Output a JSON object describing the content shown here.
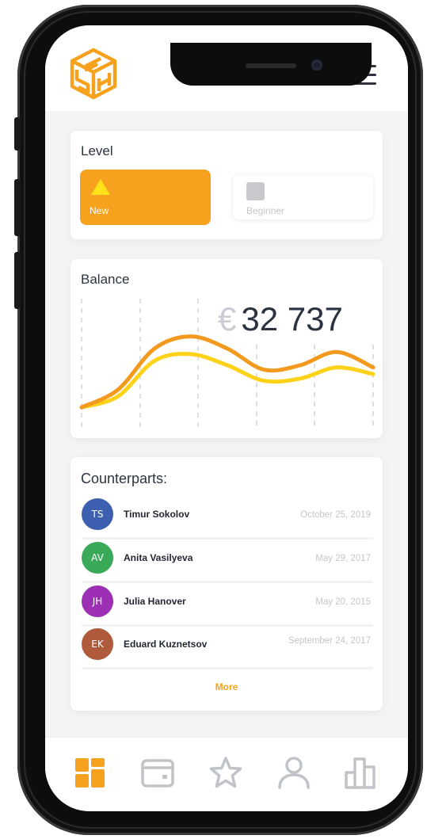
{
  "colors": {
    "accent": "#f6a21e",
    "yellow": "#ffe21a",
    "dark_text": "#2b3340",
    "muted": "#c3c6cc",
    "inactive_icon": "#c0c4c9"
  },
  "header": {
    "logo_icon": "cube-logo-icon",
    "menu_icon": "hamburger-menu-icon"
  },
  "level": {
    "title": "Level",
    "options": [
      {
        "label": "New",
        "icon": "triangle-icon",
        "selected": true
      },
      {
        "label": "Beginner",
        "icon": "square-icon",
        "selected": false
      }
    ]
  },
  "balance": {
    "title": "Balance",
    "currency": "€",
    "amount": "32 737"
  },
  "chart_data": {
    "type": "line",
    "title": "",
    "xlabel": "",
    "ylabel": "",
    "x": [
      0,
      1,
      2,
      3,
      4,
      5,
      6,
      7,
      8
    ],
    "series": [
      {
        "color": "#f39a1e",
        "values": [
          0.02,
          0.18,
          0.55,
          0.66,
          0.55,
          0.36,
          0.4,
          0.52,
          0.38
        ]
      },
      {
        "color": "#ffd21a",
        "values": [
          0.02,
          0.12,
          0.44,
          0.5,
          0.4,
          0.26,
          0.28,
          0.38,
          0.32
        ]
      }
    ],
    "grid": "vertical dashed",
    "ylim": [
      0,
      1
    ]
  },
  "counterparts": {
    "title": "Counterparts:",
    "items": [
      {
        "initials": "TS",
        "name": "Timur Sokolov",
        "date": "October 25, 2019",
        "avatar_color": "#3d5fb0"
      },
      {
        "initials": "AV",
        "name": "Anita Vasilyeva",
        "date": "May 29, 2017",
        "avatar_color": "#3aa958"
      },
      {
        "initials": "JH",
        "name": "Julia Hanover",
        "date": "May 20, 2015",
        "avatar_color": "#9d2fb5"
      },
      {
        "initials": "EK",
        "name": "Eduard Kuznetsov",
        "date": "September 24, 2017",
        "avatar_color": "#b05a3c"
      }
    ],
    "more_label": "More"
  },
  "tabbar": {
    "tabs": [
      {
        "icon": "dashboard-grid-icon",
        "active": true
      },
      {
        "icon": "wallet-icon",
        "active": false
      },
      {
        "icon": "star-icon",
        "active": false
      },
      {
        "icon": "user-icon",
        "active": false
      },
      {
        "icon": "bar-chart-icon",
        "active": false
      }
    ]
  }
}
